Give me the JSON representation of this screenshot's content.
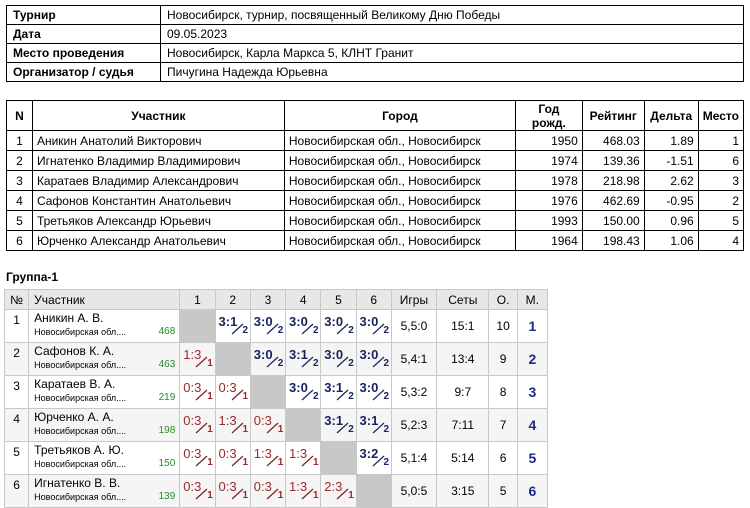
{
  "info": [
    {
      "label": "Турнир",
      "value": "Новосибирск, турнир, посвященный Великому Дню Победы"
    },
    {
      "label": "Дата",
      "value": "09.05.2023"
    },
    {
      "label": "Место проведения",
      "value": "Новосибирск, Карла Маркса 5, КЛНТ Гранит"
    },
    {
      "label": "Организатор / судья",
      "value": "Пичугина Надежда Юрьевна"
    }
  ],
  "players": {
    "headers": [
      "N",
      "Участник",
      "Город",
      "Год рожд.",
      "Рейтинг",
      "Дельта",
      "Место"
    ],
    "rows": [
      [
        "1",
        "Аникин Анатолий Викторович",
        "Новосибирская обл., Новосибирск",
        "1950",
        "468.03",
        "1.89",
        "1"
      ],
      [
        "2",
        "Игнатенко Владимир Владимирович",
        "Новосибирская обл., Новосибирск",
        "1974",
        "139.36",
        "-1.51",
        "6"
      ],
      [
        "3",
        "Каратаев Владимир Александрович",
        "Новосибирская обл., Новосибирск",
        "1978",
        "218.98",
        "2.62",
        "3"
      ],
      [
        "4",
        "Сафонов Константин Анатольевич",
        "Новосибирская обл., Новосибирск",
        "1976",
        "462.69",
        "-0.95",
        "2"
      ],
      [
        "5",
        "Третьяков Александр Юрьевич",
        "Новосибирская обл., Новосибирск",
        "1993",
        "150.00",
        "0.96",
        "5"
      ],
      [
        "6",
        "Юрченко Александр Анатольевич",
        "Новосибирская обл., Новосибирск",
        "1964",
        "198.43",
        "1.06",
        "4"
      ]
    ]
  },
  "group": {
    "title": "Группа-1",
    "headers": [
      "№",
      "Участник",
      "1",
      "2",
      "3",
      "4",
      "5",
      "6",
      "Игры",
      "Сеты",
      "О.",
      "М."
    ],
    "rows": [
      {
        "num": "1",
        "name": "Аникин А. В.",
        "city": "Новосибирская обл....",
        "rating": "468",
        "results": [
          null,
          [
            "3:1",
            "2",
            "win"
          ],
          [
            "3:0",
            "2",
            "win"
          ],
          [
            "3:0",
            "2",
            "win"
          ],
          [
            "3:0",
            "2",
            "win"
          ],
          [
            "3:0",
            "2",
            "win"
          ]
        ],
        "games": "5,5:0",
        "sets": "15:1",
        "points": "10",
        "place": "1"
      },
      {
        "num": "2",
        "name": "Сафонов К. А.",
        "city": "Новосибирская обл....",
        "rating": "463",
        "results": [
          [
            "1:3",
            "1",
            "loss"
          ],
          null,
          [
            "3:0",
            "2",
            "win"
          ],
          [
            "3:1",
            "2",
            "win"
          ],
          [
            "3:0",
            "2",
            "win"
          ],
          [
            "3:0",
            "2",
            "win"
          ]
        ],
        "games": "5,4:1",
        "sets": "13:4",
        "points": "9",
        "place": "2"
      },
      {
        "num": "3",
        "name": "Каратаев В. А.",
        "city": "Новосибирская обл....",
        "rating": "219",
        "results": [
          [
            "0:3",
            "1",
            "loss"
          ],
          [
            "0:3",
            "1",
            "loss"
          ],
          null,
          [
            "3:0",
            "2",
            "win"
          ],
          [
            "3:1",
            "2",
            "win"
          ],
          [
            "3:0",
            "2",
            "win"
          ]
        ],
        "games": "5,3:2",
        "sets": "9:7",
        "points": "8",
        "place": "3"
      },
      {
        "num": "4",
        "name": "Юрченко А. А.",
        "city": "Новосибирская обл....",
        "rating": "198",
        "results": [
          [
            "0:3",
            "1",
            "loss"
          ],
          [
            "1:3",
            "1",
            "loss"
          ],
          [
            "0:3",
            "1",
            "loss"
          ],
          null,
          [
            "3:1",
            "2",
            "win"
          ],
          [
            "3:1",
            "2",
            "win"
          ]
        ],
        "games": "5,2:3",
        "sets": "7:11",
        "points": "7",
        "place": "4"
      },
      {
        "num": "5",
        "name": "Третьяков А. Ю.",
        "city": "Новосибирская обл....",
        "rating": "150",
        "results": [
          [
            "0:3",
            "1",
            "loss"
          ],
          [
            "0:3",
            "1",
            "loss"
          ],
          [
            "1:3",
            "1",
            "loss"
          ],
          [
            "1:3",
            "1",
            "loss"
          ],
          null,
          [
            "3:2",
            "2",
            "win"
          ]
        ],
        "games": "5,1:4",
        "sets": "5:14",
        "points": "6",
        "place": "5"
      },
      {
        "num": "6",
        "name": "Игнатенко В. В.",
        "city": "Новосибирская обл....",
        "rating": "139",
        "results": [
          [
            "0:3",
            "1",
            "loss"
          ],
          [
            "0:3",
            "1",
            "loss"
          ],
          [
            "0:3",
            "1",
            "loss"
          ],
          [
            "1:3",
            "1",
            "loss"
          ],
          [
            "2:3",
            "1",
            "loss"
          ],
          null
        ],
        "games": "5,0:5",
        "sets": "3:15",
        "points": "5",
        "place": "6"
      }
    ]
  }
}
